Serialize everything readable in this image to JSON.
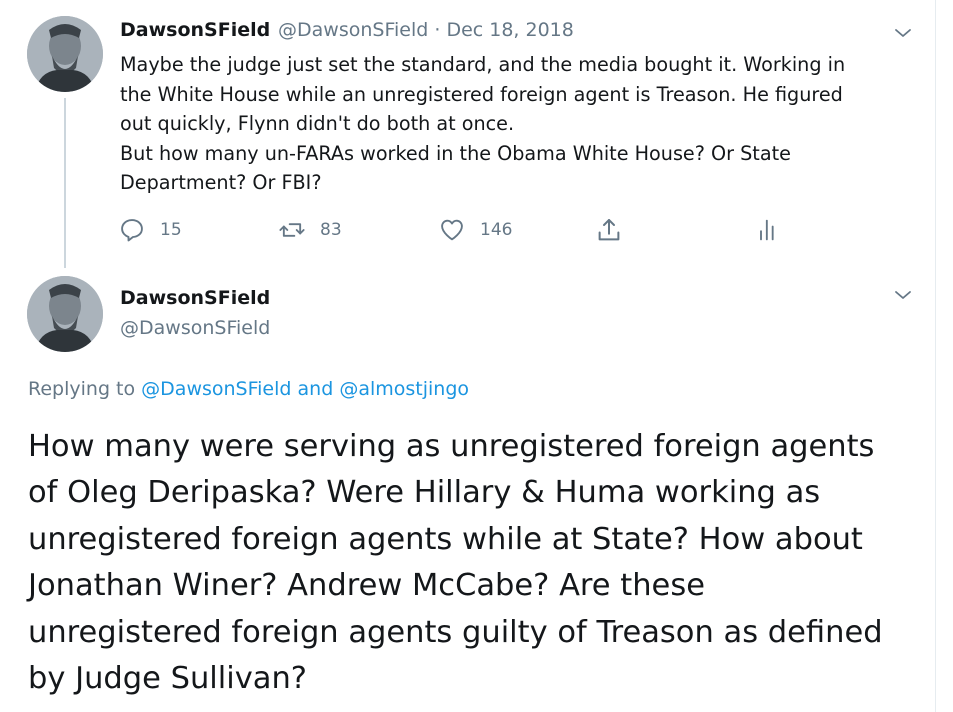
{
  "colors": {
    "text": "#14171a",
    "secondary": "#657786",
    "link": "#1b95e0",
    "divider": "#e6ecf0",
    "thread_line": "#ccd6dd"
  },
  "tweet1": {
    "author_name": "DawsonSField",
    "author_handle": "@DawsonSField",
    "separator": "·",
    "date": "Dec 18, 2018",
    "text_lines": [
      "Maybe the judge just set the standard, and the media bought it. Working in",
      "the White House while an unregistered foreign agent is Treason. He figured",
      "out quickly, Flynn didn't do both at once.",
      "But how many un-FARAs worked in the Obama White House? Or State",
      "Department? Or FBI?"
    ],
    "actions": {
      "reply": {
        "icon": "reply-icon",
        "count": "15"
      },
      "retweet": {
        "icon": "retweet-icon",
        "count": "83"
      },
      "like": {
        "icon": "heart-icon",
        "count": "146"
      },
      "share": {
        "icon": "share-icon"
      },
      "analytics": {
        "icon": "analytics-icon"
      }
    }
  },
  "tweet2": {
    "author_name": "DawsonSField",
    "author_handle": "@DawsonSField",
    "replying_prefix": "Replying to",
    "replying_user1": "@DawsonSField",
    "replying_and": "and",
    "replying_user2": "@almostjingo",
    "text_lines": [
      "How many were serving as unregistered foreign agents",
      "of Oleg Deripaska? Were Hillary & Huma working as",
      "unregistered foreign agents while at State? How about",
      "Jonathan Winer? Andrew McCabe? Are these",
      "unregistered foreign agents guilty of Treason as defined",
      "by Judge Sullivan?"
    ]
  }
}
